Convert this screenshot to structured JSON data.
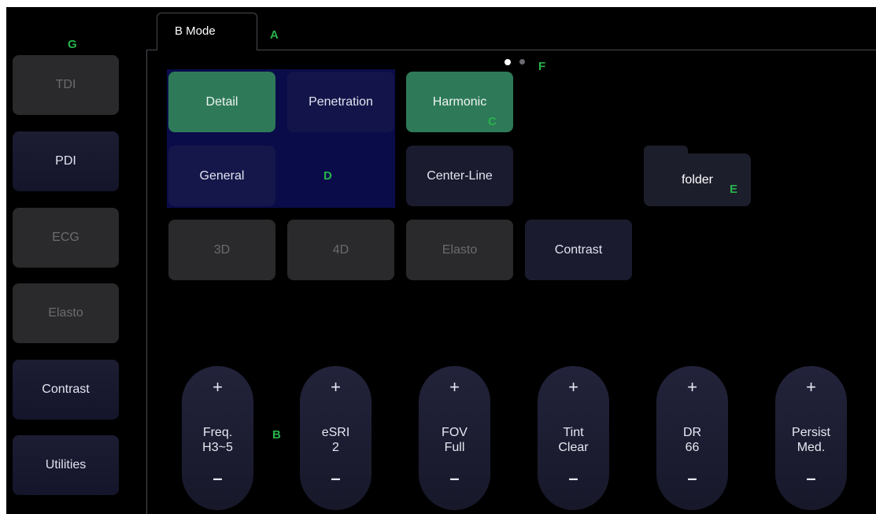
{
  "callouts": {
    "a": "A",
    "b": "B",
    "c": "C",
    "d": "D",
    "e": "E",
    "f": "F",
    "g": "G"
  },
  "tab": {
    "label": "B Mode"
  },
  "sidebar": {
    "items": [
      {
        "label": "TDI",
        "enabled": false
      },
      {
        "label": "PDI",
        "enabled": true
      },
      {
        "label": "ECG",
        "enabled": false
      },
      {
        "label": "Elasto",
        "enabled": false
      },
      {
        "label": "Contrast",
        "enabled": true
      },
      {
        "label": "Utilities",
        "enabled": true
      }
    ]
  },
  "modes": {
    "detail": "Detail",
    "penetration": "Penetration",
    "harmonic": "Harmonic",
    "general": "General",
    "center_line": "Center-Line",
    "three_d": "3D",
    "four_d": "4D",
    "elasto": "Elasto",
    "contrast": "Contrast"
  },
  "folder": {
    "label": "folder"
  },
  "pager": {
    "current_page": 1,
    "total_pages": 2
  },
  "knobs": [
    {
      "plus": "+",
      "name": "Freq.",
      "value": "H3~5",
      "minus": "–"
    },
    {
      "plus": "+",
      "name": "eSRI",
      "value": "2",
      "minus": "–"
    },
    {
      "plus": "+",
      "name": "FOV",
      "value": "Full",
      "minus": "–"
    },
    {
      "plus": "+",
      "name": "Tint",
      "value": "Clear",
      "minus": "–"
    },
    {
      "plus": "+",
      "name": "DR",
      "value": "66",
      "minus": "–"
    },
    {
      "plus": "+",
      "name": "Persist",
      "value": "Med.",
      "minus": "–"
    }
  ],
  "colors": {
    "active_green": "#2e7a58",
    "group_blue": "#0a0c4a",
    "callout_green": "#27b34a"
  }
}
